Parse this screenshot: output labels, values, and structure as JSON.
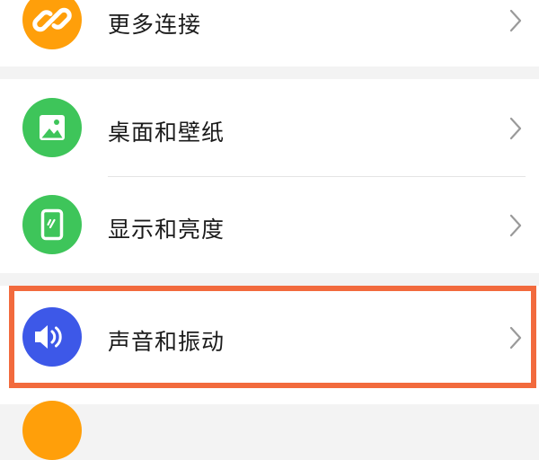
{
  "settings": {
    "items": [
      {
        "label": "更多连接",
        "icon": "link-icon",
        "icon_color": "#ff9f0a"
      },
      {
        "label": "桌面和壁纸",
        "icon": "image-icon",
        "icon_color": "#3ec55a"
      },
      {
        "label": "显示和亮度",
        "icon": "phone-display-icon",
        "icon_color": "#3ec55a"
      },
      {
        "label": "声音和振动",
        "icon": "speaker-icon",
        "icon_color": "#3d58e8"
      }
    ],
    "highlight_color": "#f26a3d",
    "next_icon_color": "#ff9f0a"
  }
}
